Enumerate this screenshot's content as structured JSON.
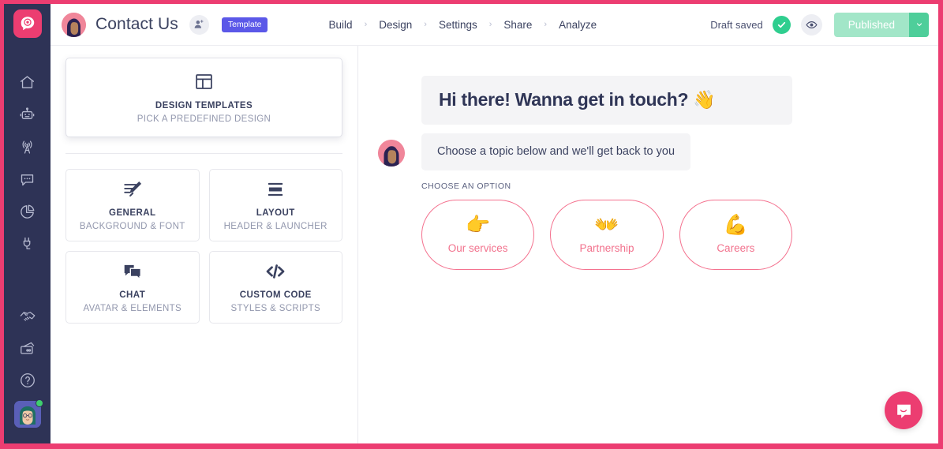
{
  "brand": {
    "accent_pink": "#ec3d71",
    "rail_bg": "#2e3356",
    "text_dark": "#3b4260",
    "green": "#2fce8f",
    "option_border": "#f4728f"
  },
  "sidebar": {
    "logo_name": "chatbot-logo",
    "items": [
      {
        "name": "home",
        "label": "Home"
      },
      {
        "name": "bot",
        "label": "Bots"
      },
      {
        "name": "broadcast",
        "label": "Broadcast"
      },
      {
        "name": "chat",
        "label": "Chat"
      },
      {
        "name": "analytics",
        "label": "Analytics"
      },
      {
        "name": "integrations",
        "label": "Integrations"
      },
      {
        "name": "partners",
        "label": "Partners"
      },
      {
        "name": "billing",
        "label": "Billing"
      },
      {
        "name": "help",
        "label": "Help"
      }
    ],
    "avatar_status": "online"
  },
  "topbar": {
    "title": "Contact Us",
    "add_user_icon": "add-user-icon",
    "badge": "Template",
    "nav": [
      {
        "label": "Build"
      },
      {
        "label": "Design"
      },
      {
        "label": "Settings"
      },
      {
        "label": "Share"
      },
      {
        "label": "Analyze"
      }
    ],
    "nav_separator": "›",
    "draft_status": "Draft saved",
    "saved_icon": "check-icon",
    "preview_icon": "eye-icon",
    "publish_label": "Published",
    "publish_arrow": "ˇ"
  },
  "panel": {
    "featured": {
      "title": "DESIGN TEMPLATES",
      "subtitle": "PICK A PREDEFINED DESIGN",
      "icon": "layout-template-icon"
    },
    "cards": [
      {
        "title": "GENERAL",
        "subtitle": "BACKGROUND & FONT",
        "icon": "edit-lines-icon"
      },
      {
        "title": "LAYOUT",
        "subtitle": "HEADER & LAUNCHER",
        "icon": "layout-bars-icon"
      },
      {
        "title": "CHAT",
        "subtitle": "AVATAR & ELEMENTS",
        "icon": "chat-bubbles-icon"
      },
      {
        "title": "CUSTOM CODE",
        "subtitle": "STYLES & SCRIPTS",
        "icon": "code-icon"
      }
    ]
  },
  "preview": {
    "greeting": "Hi there! Wanna get in touch? ",
    "greeting_emoji": "👋",
    "message": "Choose a topic below and we'll get back to you",
    "choose_label": "CHOOSE AN OPTION",
    "options": [
      {
        "emoji": "👉",
        "label": "Our services"
      },
      {
        "emoji": "👐",
        "label": "Partnership"
      },
      {
        "emoji": "💪",
        "label": "Careers"
      }
    ],
    "launcher_icon": "chat-launcher-icon"
  }
}
